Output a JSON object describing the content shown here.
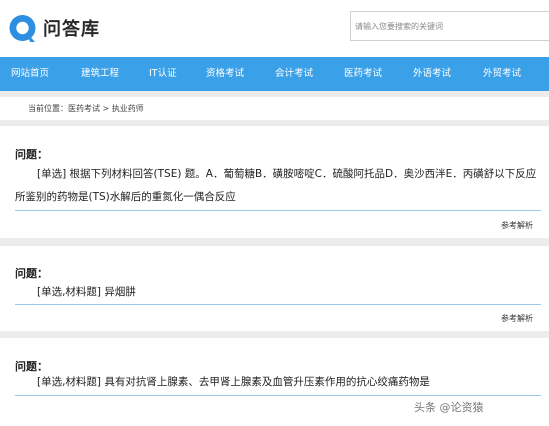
{
  "site": {
    "logo_text": "问答库"
  },
  "search": {
    "placeholder": "请输入您要搜索的关键词"
  },
  "nav": {
    "items": [
      "网站首页",
      "建筑工程",
      "IT认证",
      "资格考试",
      "会计考试",
      "医药考试",
      "外语考试",
      "外贸考试"
    ]
  },
  "breadcrumb": {
    "text": "当前位置：医药考试 > 执业药师"
  },
  "questions": [
    {
      "title": "问题：",
      "text": "[单选] 根据下列材料回答(TSE) 题。A．葡萄糖B．磺胺嘧啶C．硫酸阿托品D．奥沙西泮E．丙磺舒以下反应所鉴别的药物是(TS)水解后的重氮化一偶合反应",
      "analysis": "参考解析"
    },
    {
      "title": "问题：",
      "text": "[单选,材料题]  异烟肼",
      "analysis": "参考解析"
    },
    {
      "title": "问题：",
      "text": "[单选,材料题] 具有对抗肾上腺素、去甲肾上腺素及血管升压素作用的抗心绞痛药物是",
      "analysis": ""
    }
  ],
  "watermark": {
    "text": "头条 @论资猿"
  },
  "colors": {
    "nav_bg": "#3aa0e8",
    "logo_blue": "#2e8fe0",
    "underline": "#9cc8ea"
  }
}
